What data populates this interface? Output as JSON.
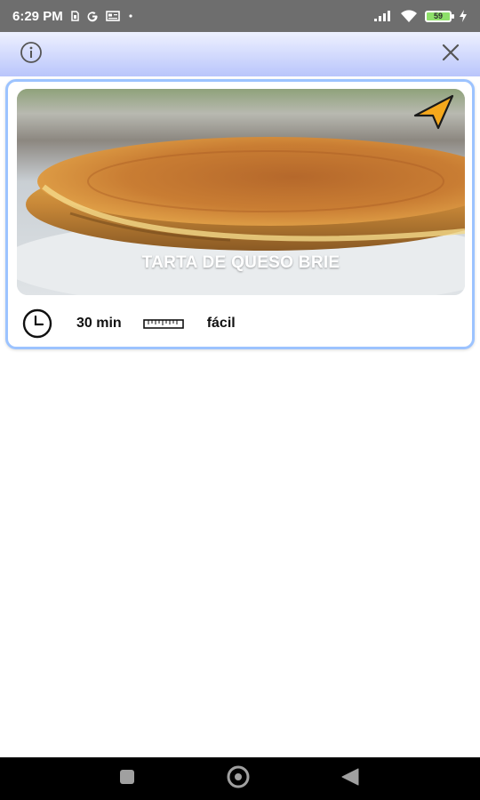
{
  "status_bar": {
    "time": "6:29 PM",
    "left_icons": [
      "sim-icon",
      "google-icon",
      "news-icon",
      "dot-icon"
    ],
    "battery_level": "59"
  },
  "top_bar": {
    "info_icon": "info-icon",
    "close_icon": "close-icon"
  },
  "recipe": {
    "title": "TARTA DE QUESO BRIE",
    "time": "30 min",
    "difficulty": "fácil",
    "share_icon": "navigation-arrow-icon",
    "accent_color": "#f5a81c"
  },
  "nav_bar": {
    "buttons": [
      "recents-button",
      "home-button",
      "back-button"
    ]
  }
}
